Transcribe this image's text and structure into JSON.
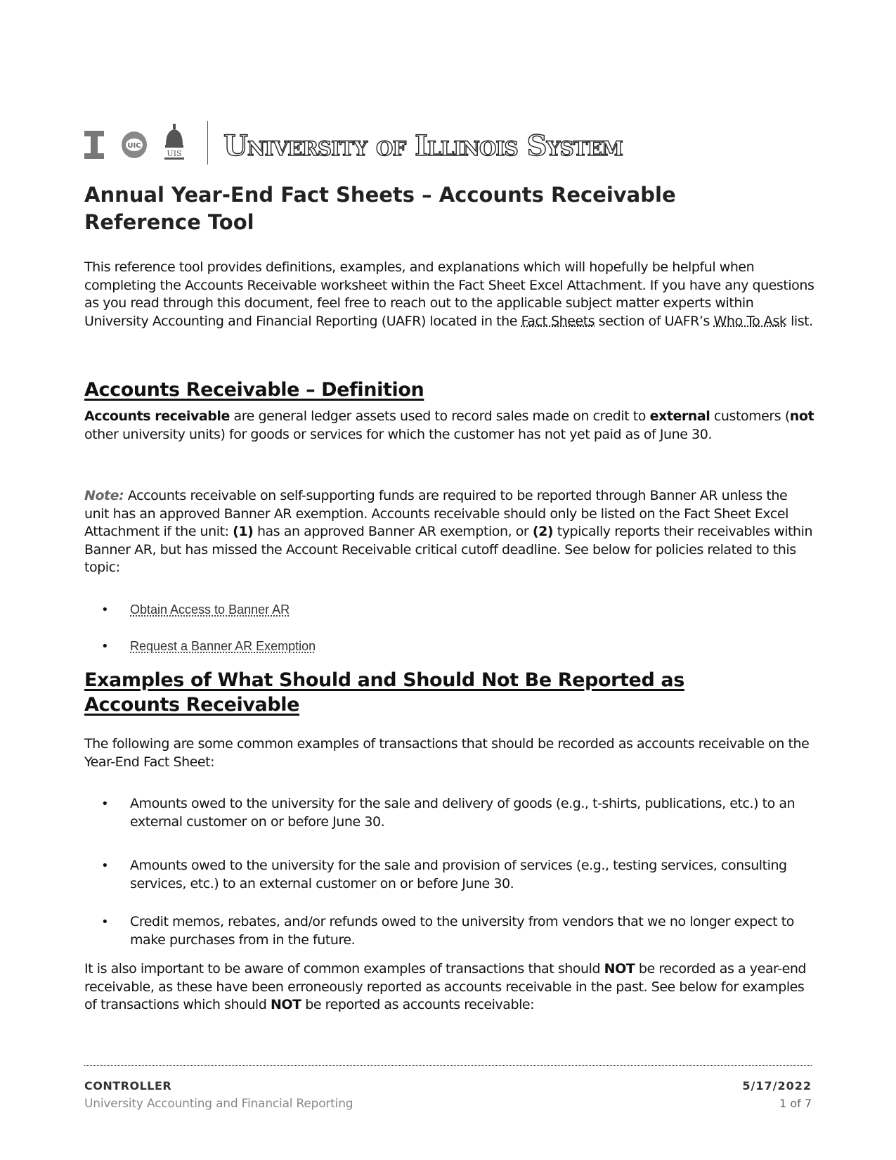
{
  "header": {
    "logos": [
      "illinois-block-i-logo",
      "uic-seal-logo",
      "uis-dome-logo"
    ],
    "system_name": "University of Illinois System"
  },
  "document": {
    "title_line1": "Annual Year-End Fact Sheets – Accounts Receivable",
    "title_line2": "Reference Tool",
    "intro": {
      "text_before_link1": "This reference tool provides definitions, examples, and explanations which will hopefully be helpful when completing the Accounts Receivable worksheet within the Fact Sheet Excel Attachment. If you have any questions as you read through this document, feel free to reach out to the applicable subject matter experts within University Accounting and Financial Reporting (UAFR) located in the ",
      "link1": "Fact Sheets",
      "text_between_links": " section of UAFR’s ",
      "link2": "Who To Ask",
      "text_after_link2": " list."
    },
    "definition_section": {
      "heading": "Accounts Receivable – Definition",
      "term": "Accounts receivable",
      "text1": " are general ledger assets used to record sales made on credit to ",
      "bold_external": "external",
      "text2": " customers (",
      "bold_not": "not",
      "text3": " other university units) for goods or services for which the customer has not yet paid as of June 30."
    },
    "note": {
      "label": "Note:",
      "text1": " Accounts receivable on self-supporting funds are required to be reported through Banner AR unless the unit has an approved Banner AR exemption. Accounts receivable should only be listed on the Fact Sheet Excel Attachment if the unit: ",
      "num1": "(1)",
      "text2": " has an approved Banner AR exemption, or ",
      "num2": "(2)",
      "text3": " typically reports their receivables within Banner AR, but has missed the Account Receivable critical cutoff deadline. See below for policies related to this topic:"
    },
    "policy_links": [
      "Obtain Access to Banner AR",
      "Request a Banner AR Exemption"
    ],
    "examples_section": {
      "heading_line1": "Examples of What Should and Should Not Be Reported as",
      "heading_line2": "Accounts Receivable",
      "intro": "The following are some common examples of transactions that should be recorded as accounts receivable on the Year-End Fact Sheet:",
      "items": [
        "Amounts owed to the university for the sale and delivery of goods (e.g., t-shirts, publications, etc.) to an external customer on or before June 30.",
        "Amounts owed to the university for the sale and provision of services (e.g., testing services, consulting services, etc.) to an external customer on or before June 30.",
        "Credit memos, rebates, and/or refunds owed to the university from vendors that we no longer expect to make purchases from in the future."
      ],
      "closing": {
        "text1": "It is also important to be aware of common examples of transactions that should ",
        "bold1": "NOT",
        "text2": " be recorded as a year-end receivable, as these have been erroneously reported as accounts receivable in the past. See below for examples of transactions which should ",
        "bold2": "NOT",
        "text3": " be reported as accounts receivable:"
      }
    }
  },
  "footer": {
    "office": "CONTROLLER",
    "department": "University Accounting and Financial Reporting",
    "date": "5/17/2022",
    "page": "1 of 7"
  }
}
